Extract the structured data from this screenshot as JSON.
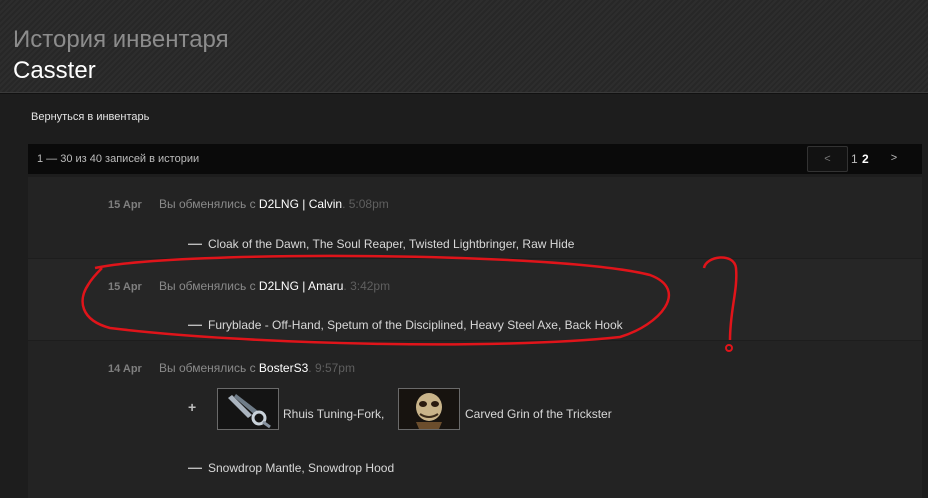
{
  "header": {
    "title": "История инвентаря",
    "username": "Casster"
  },
  "back_link": "Вернуться в инвентарь",
  "pager": {
    "summary": "1 — 30 из 40 записей в истории",
    "prev": "<",
    "pages": [
      "1",
      "2"
    ],
    "current_page": "2",
    "next": ">"
  },
  "entries": [
    {
      "date": "15 Apr",
      "prefix": "Вы обменялись с ",
      "partner": "D2LNG | Calvin",
      "time": ". 5:08pm",
      "lost_sign": "—",
      "lost_items": "Cloak of the Dawn, The Soul Reaper, Twisted Lightbringer, Raw Hide"
    },
    {
      "date": "15 Apr",
      "prefix": "Вы обменялись с ",
      "partner": "D2LNG | Amaru",
      "time": ". 3:42pm",
      "lost_sign": "—",
      "lost_items": "Furyblade - Off-Hand, Spetum of the Disciplined, Heavy Steel Axe, Back Hook"
    },
    {
      "date": "14 Apr",
      "prefix": "Вы обменялись с ",
      "partner": "BosterS3",
      "time": ". 9:57pm",
      "gained_sign": "+",
      "gained_items": [
        {
          "name": "Rhuis Tuning-Fork,",
          "icon": "tuning-fork-weapon-icon"
        },
        {
          "name": "Carved Grin of the Trickster",
          "icon": "skull-mask-icon"
        }
      ],
      "lost_sign": "—",
      "lost_items": "Snowdrop Mantle, Snowdrop Hood"
    }
  ],
  "annotation": {
    "question_mark": "?"
  },
  "colors": {
    "annotation_red": "#e0141a",
    "background": "#2a2a2a",
    "panel": "#1d1d1d"
  }
}
